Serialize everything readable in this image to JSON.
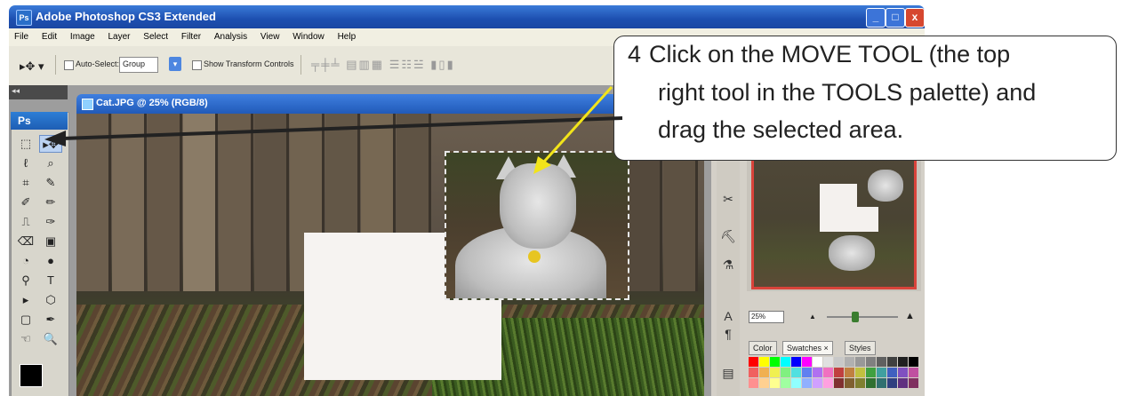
{
  "window": {
    "title": "Adobe Photoshop CS3 Extended",
    "icon": "photoshop-icon",
    "min_label": "_",
    "max_label": "□",
    "close_label": "x"
  },
  "menu": [
    "File",
    "Edit",
    "Image",
    "Layer",
    "Select",
    "Filter",
    "Analysis",
    "View",
    "Window",
    "Help"
  ],
  "options": {
    "tool_glyph": "▸✥ ▾",
    "auto_select_label": "Auto-Select:",
    "auto_select_value": "Group",
    "show_transform_label": "Show Transform Controls",
    "align_icons": "╤╪╧ ▤▥▦ ☰☷☱ ▮▯▮"
  },
  "tools_palette": {
    "logo": "Ps",
    "collapse": "◂◂",
    "rows": [
      [
        "⬚",
        "▸✥"
      ],
      [
        "ℓ",
        "⌕"
      ],
      [
        "⌗",
        "✎"
      ],
      [
        "✐",
        "✏"
      ],
      [
        "⎍",
        "✑"
      ],
      [
        "⌫",
        "▣"
      ],
      [
        "◔",
        "●"
      ],
      [
        "⚲",
        "T"
      ],
      [
        "▸",
        "⬡"
      ],
      [
        "▢",
        "✒"
      ],
      [
        "☜",
        "🔍"
      ]
    ]
  },
  "document": {
    "title": "Cat.JPG @ 25% (RGB/8)",
    "icon": "document-icon"
  },
  "navigator": {
    "zoom": "25%",
    "zoom_level": 0.4
  },
  "panel_tabs": [
    "Color",
    "Swatches ×",
    "Styles"
  ],
  "swatch_colors": [
    "#ff0000",
    "#ffff00",
    "#00ff00",
    "#00ffff",
    "#0000ff",
    "#ff00ff",
    "#ffffff",
    "#e0e0e0",
    "#c8c8c8",
    "#b0b0b0",
    "#989898",
    "#808080",
    "#606060",
    "#404040",
    "#202020",
    "#000000",
    "#f06060",
    "#f0b050",
    "#f0f050",
    "#80f080",
    "#50e0e0",
    "#6080f0",
    "#b070f0",
    "#f070c0",
    "#c04040",
    "#c08040",
    "#c0c040",
    "#40a040",
    "#40a0a0",
    "#4060c0",
    "#8050c0",
    "#c050a0",
    "#ff9090",
    "#ffd090",
    "#ffff90",
    "#a0ffa0",
    "#90ffff",
    "#90b0ff",
    "#d0a0ff",
    "#ffa0e0",
    "#803030",
    "#806030",
    "#808030",
    "#307030",
    "#307070",
    "#304080",
    "#603080",
    "#803060"
  ],
  "side_icons": [
    "✂",
    "⛏",
    "⚗",
    "A",
    "¶",
    "▤"
  ],
  "callout": {
    "number": "4",
    "line1": "Click on the MOVE TOOL (the top",
    "line2": "right tool in the TOOLS palette) and",
    "line3": "drag the selected area."
  },
  "colors": {
    "arrow_black": "#222222",
    "arrow_yellow": "#f2e41a"
  }
}
